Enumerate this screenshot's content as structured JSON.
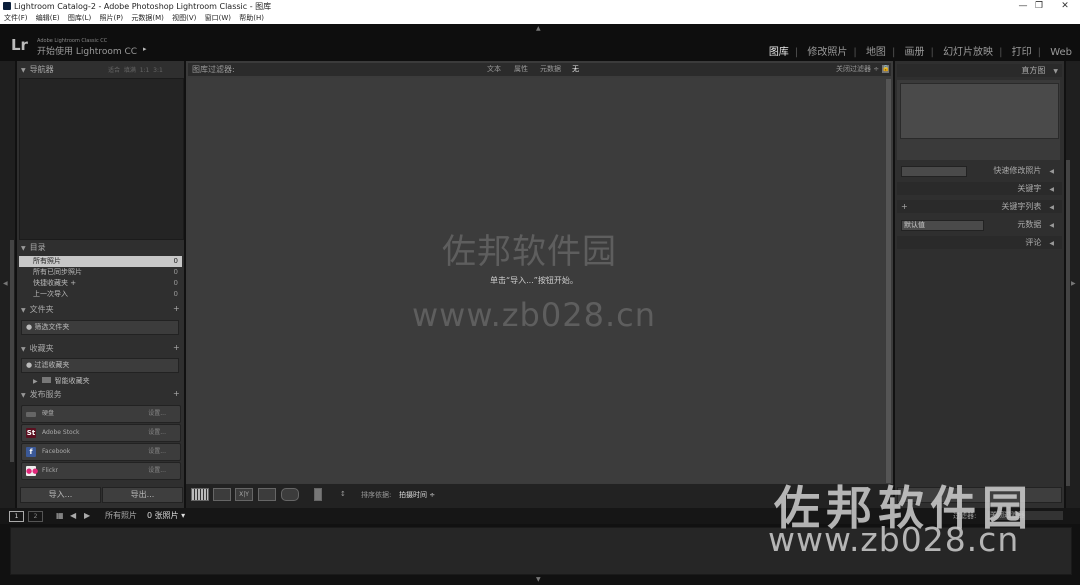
{
  "window": {
    "title": "Lightroom Catalog-2 - Adobe Photoshop Lightroom Classic - 图库",
    "controls": {
      "minimize": "—",
      "maximize": "❐",
      "close": "✕"
    }
  },
  "menubar": [
    "文件(F)",
    "编辑(E)",
    "图库(L)",
    "照片(P)",
    "元数据(M)",
    "视图(V)",
    "窗口(W)",
    "帮助(H)"
  ],
  "identity": {
    "logo": "Lr",
    "version_line": "Adobe Lightroom Classic CC",
    "tagline": "开始使用 Lightroom CC",
    "tagline_arrow": "▸"
  },
  "modules": {
    "items": [
      "图库",
      "修改照片",
      "地图",
      "画册",
      "幻灯片放映",
      "打印",
      "Web"
    ],
    "active": "图库"
  },
  "left_panel": {
    "navigator": {
      "title": "导航器",
      "options": [
        "适合",
        "填满",
        "1:1",
        "3:1"
      ]
    },
    "catalog": {
      "title": "目录",
      "items": [
        {
          "label": "所有照片",
          "count": "0",
          "selected": true
        },
        {
          "label": "所有已同步照片",
          "count": "0"
        },
        {
          "label": "快捷收藏夹 +",
          "count": "0"
        },
        {
          "label": "上一次导入",
          "count": "0"
        }
      ]
    },
    "folders": {
      "title": "文件夹",
      "filter_label": "筛选文件夹"
    },
    "collections": {
      "title": "收藏夹",
      "filter_label": "过滤收藏夹",
      "smart_label": "智能收藏夹"
    },
    "publish": {
      "title": "发布服务",
      "services": [
        {
          "name": "硬盘",
          "action": "设置..."
        },
        {
          "name": "Adobe Stock",
          "action": "设置..."
        },
        {
          "name": "Facebook",
          "action": "设置..."
        },
        {
          "name": "Flickr",
          "action": "设置..."
        }
      ]
    },
    "import_label": "导入...",
    "export_label": "导出..."
  },
  "center": {
    "filter_title": "图库过滤器:",
    "filter_tabs": [
      "文本",
      "属性",
      "元数据",
      "无"
    ],
    "filter_active": "无",
    "filter_off": "关闭过滤器 ÷",
    "hint": "单击“导入...”按钮开始。",
    "watermark_text": "佐邦软件园",
    "watermark_url": "www.zb028.cn",
    "toolbar": {
      "sort_label": "排序依据:",
      "sort_value": "拍摄时间 ÷"
    }
  },
  "right_panel": {
    "sections": [
      "直方图",
      "快速修改照片",
      "关键字",
      "关键字列表",
      "元数据",
      "评论"
    ],
    "metadata_preset": "默认值",
    "quick_develop_preset": ""
  },
  "filmstrip": {
    "pages": [
      "1",
      "2"
    ],
    "source": "所有照片",
    "count": "0 张照片 ▾",
    "filter_label": "过滤器:",
    "filter_value": "关闭过滤器"
  },
  "overlay_watermark": {
    "text": "佐邦软件园",
    "url": "www.zb028.cn"
  }
}
